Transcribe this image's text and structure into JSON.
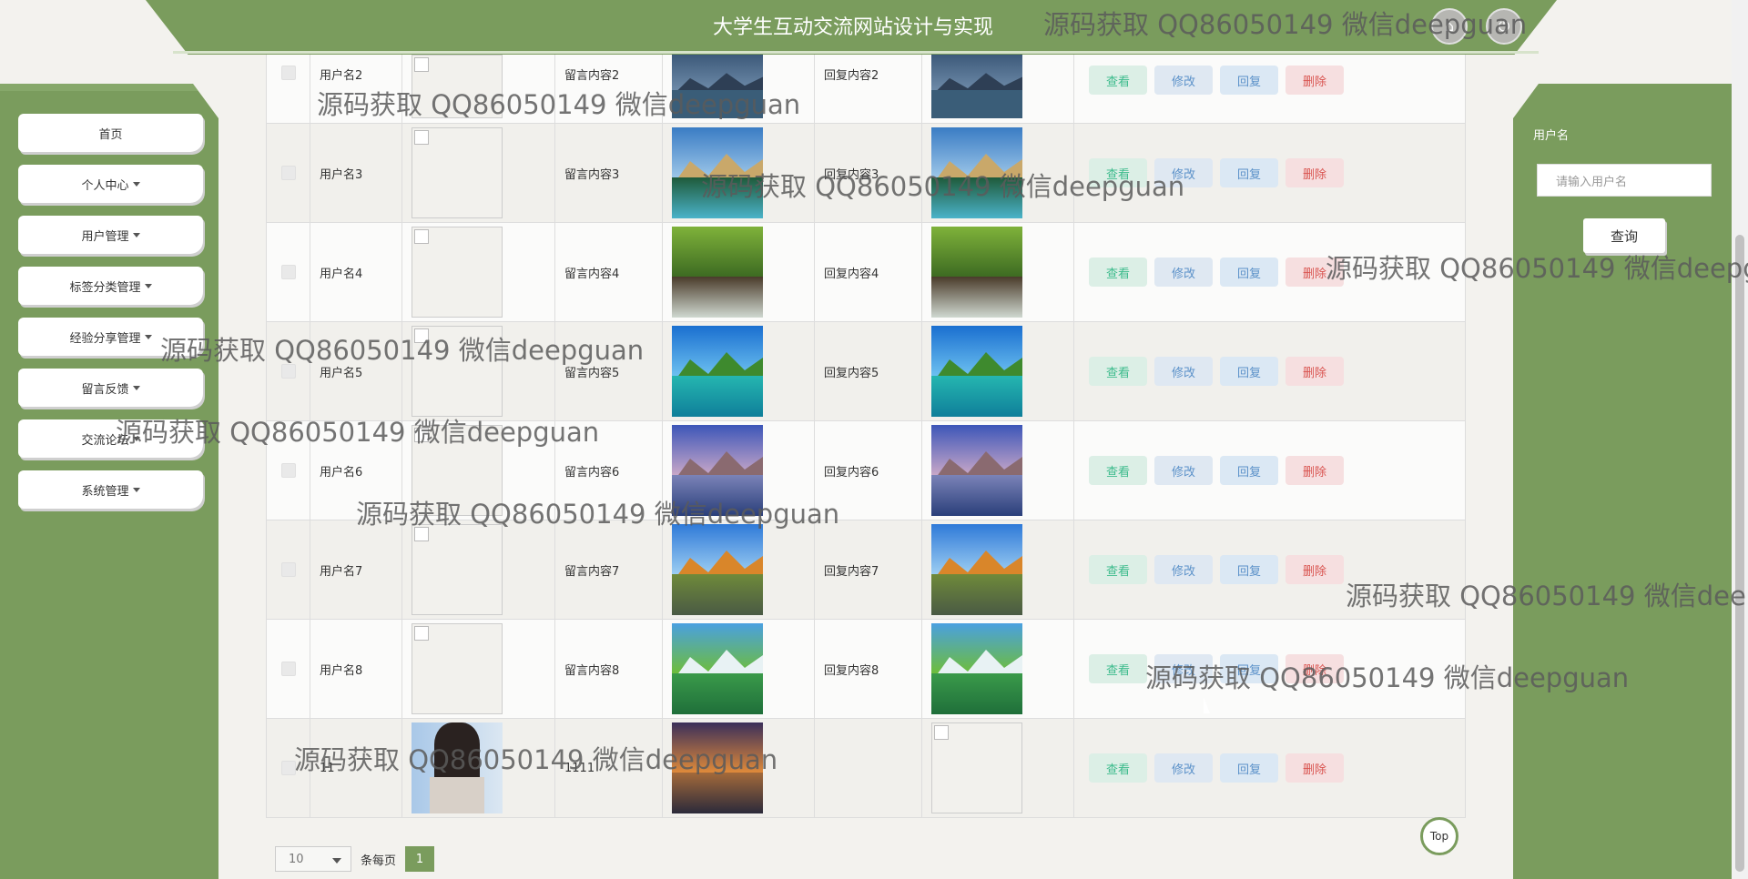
{
  "header": {
    "title": "大学生互动交流网站设计与实现"
  },
  "sidebar": {
    "items": [
      {
        "label": "首页",
        "dropdown": false
      },
      {
        "label": "个人中心",
        "dropdown": true
      },
      {
        "label": "用户管理",
        "dropdown": true
      },
      {
        "label": "标签分类管理",
        "dropdown": true
      },
      {
        "label": "经验分享管理",
        "dropdown": true
      },
      {
        "label": "留言反馈",
        "dropdown": true
      },
      {
        "label": "交流论坛",
        "dropdown": true
      },
      {
        "label": "系统管理",
        "dropdown": true
      }
    ]
  },
  "search": {
    "label": "用户名",
    "placeholder": "请输入用户名",
    "button": "查询"
  },
  "actions": {
    "view": "查看",
    "edit": "修改",
    "reply": "回复",
    "delete": "删除"
  },
  "rows": [
    {
      "username": "用户名2",
      "message": "留言内容2",
      "reply": "回复内容2"
    },
    {
      "username": "用户名3",
      "message": "留言内容3",
      "reply": "回复内容3"
    },
    {
      "username": "用户名4",
      "message": "留言内容4",
      "reply": "回复内容4"
    },
    {
      "username": "用户名5",
      "message": "留言内容5",
      "reply": "回复内容5"
    },
    {
      "username": "用户名6",
      "message": "留言内容6",
      "reply": "回复内容6"
    },
    {
      "username": "用户名7",
      "message": "留言内容7",
      "reply": "回复内容7"
    },
    {
      "username": "用户名8",
      "message": "留言内容8",
      "reply": "回复内容8"
    },
    {
      "username": "11",
      "message": "1111",
      "reply": ""
    }
  ],
  "pagination": {
    "page_size": "10",
    "per_page_label": "条每页",
    "current_page": "1"
  },
  "top_button": "Top",
  "watermark": "源码获取 QQ86050149 微信deepguan",
  "colors": {
    "primary": "#7a9c5d",
    "view": "#3dbb8c",
    "edit": "#5b91c9",
    "delete": "#d9534f"
  }
}
